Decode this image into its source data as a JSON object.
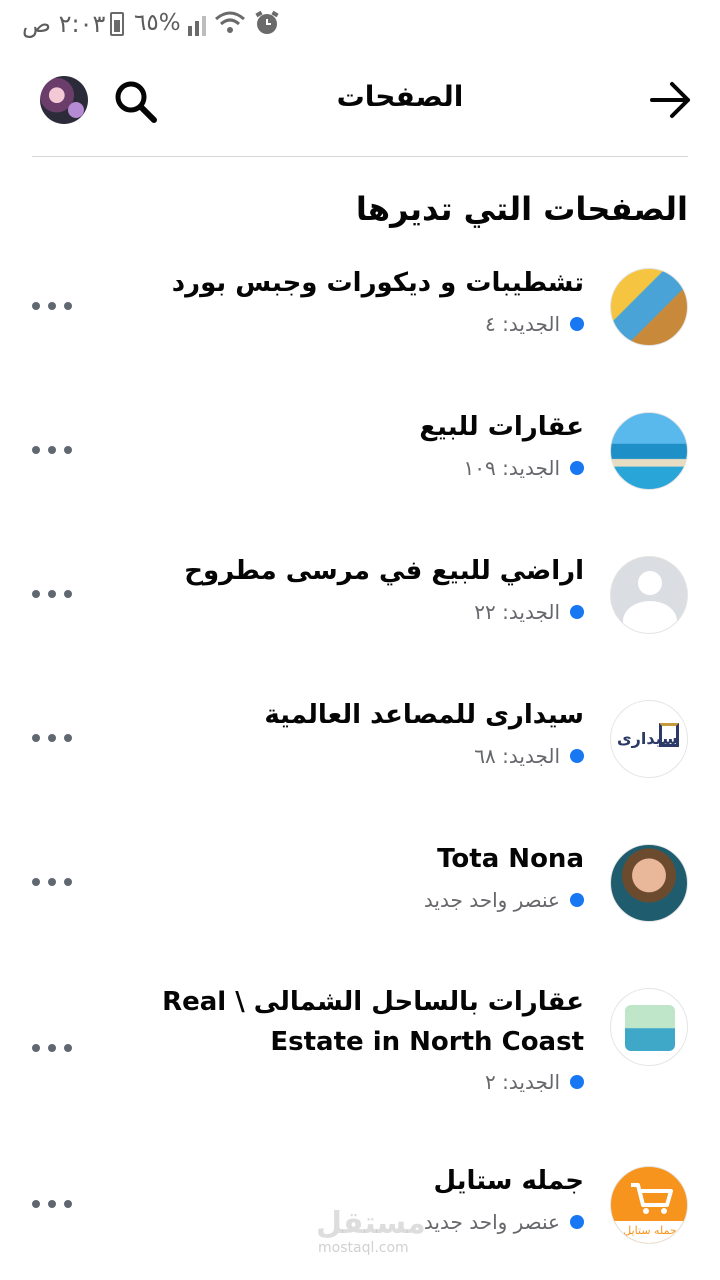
{
  "status_bar": {
    "time": "٢:٠٣ ص",
    "battery": "%٦٥"
  },
  "header": {
    "title": "الصفحات"
  },
  "section": {
    "title": "الصفحات التي تديرها"
  },
  "pages": [
    {
      "name": "تشطيبات و ديكورات وجبس بورد",
      "meta": "الجديد: ٤"
    },
    {
      "name": "عقارات للبيع",
      "meta": "الجديد: ١٠٩"
    },
    {
      "name": "اراضي للبيع في مرسى مطروح",
      "meta": "الجديد: ٢٢"
    },
    {
      "name": "سيدارى للمصاعد العالمية",
      "meta": "الجديد: ٦٨",
      "avatar_text": "سيدارى"
    },
    {
      "name": "Tota Nona",
      "meta": "عنصر واحد جديد"
    },
    {
      "name": "عقارات بالساحل الشمالى \\ Real Estate in North Coast",
      "meta": "الجديد: ٢"
    },
    {
      "name": "جمله ستايل",
      "meta": "عنصر واحد جديد",
      "avatar_text": "جمله ستايل"
    }
  ],
  "watermark": {
    "main": "مستقل",
    "sub": "mostaql.com"
  },
  "colors": {
    "accent_dot": "#1877f2",
    "text": "#050505",
    "meta": "#65676b"
  }
}
